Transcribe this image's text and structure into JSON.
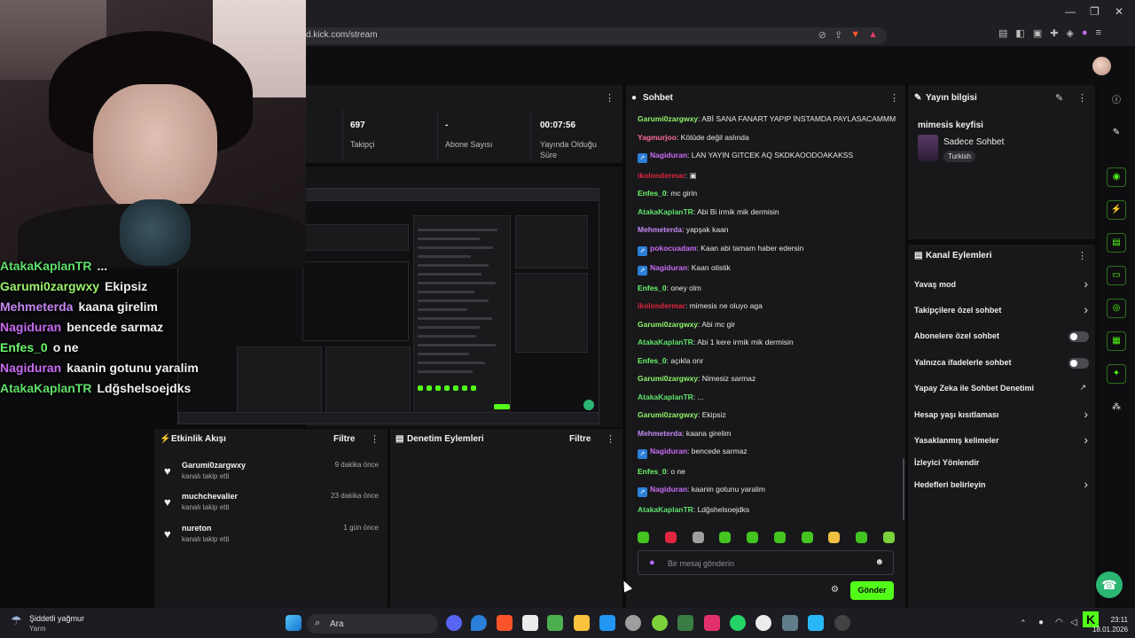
{
  "browser": {
    "url": "d.kick.com/stream",
    "window_controls": [
      "—",
      "❐",
      "✕"
    ]
  },
  "stats": [
    {
      "value": "697",
      "label": "Takipçi"
    },
    {
      "value": "-",
      "label": "Abone Sayısı"
    },
    {
      "value": "00:07:56",
      "label": "Yayında Olduğu Süre"
    }
  ],
  "overlay_chat": [
    {
      "user": "AtakaKaplanTR",
      "msg": "...",
      "color": "#5fe06a"
    },
    {
      "user": "Garumi0zargwxy",
      "msg": "Ekipsiz",
      "color": "#9cf26b"
    },
    {
      "user": "Mehmeterda",
      "msg": "kaana girelim",
      "color": "#c688f5"
    },
    {
      "user": "Nagiduran",
      "msg": "bencede sarmaz",
      "color": "#c86cf2"
    },
    {
      "user": "Enfes_0",
      "msg": "o ne",
      "color": "#6df76d"
    },
    {
      "user": "Nagiduran",
      "msg": "kaanin gotunu yaralim",
      "color": "#c86cf2"
    },
    {
      "user": "AtakaKaplanTR",
      "msg": "Ldğshelsoejdks",
      "color": "#5fe06a"
    }
  ],
  "activity": {
    "title": "Etkinlik Akışı",
    "filter": "Filtre",
    "events": [
      {
        "name": "Garumi0zargwxy",
        "sub": "kanalı takip etti",
        "time": "9 dakika önce"
      },
      {
        "name": "muchchevalier",
        "sub": "kanalı takip etti",
        "time": "23 dakika önce"
      },
      {
        "name": "nureton",
        "sub": "kanalı takip etti",
        "time": "1 gün önce"
      }
    ]
  },
  "moderation": {
    "title": "Denetim Eylemleri",
    "filter": "Filtre"
  },
  "chat": {
    "title": "Sohbet",
    "messages": [
      {
        "user": "Garumi0zargwxy",
        "color": "#8ff56b",
        "badge": "",
        "text": "ABİ SANA FANART YAPIP İNSTAMDA PAYLASACAMMM"
      },
      {
        "user": "Yagmurjoo",
        "color": "#ff6b9a",
        "badge": "",
        "text": "Kötüde değil aslında"
      },
      {
        "user": "Nagiduran",
        "color": "#c86cf2",
        "badge": "⇗",
        "text": "LAN YAYIN GITCEK AQ SKDKAOODOAKAKSS"
      },
      {
        "user": "ikolondermar",
        "color": "#e0263e",
        "badge": "",
        "text": "▣"
      },
      {
        "user": "Enfes_0",
        "color": "#6df76d",
        "badge": "",
        "text": "mc girin"
      },
      {
        "user": "AtakaKaplanTR",
        "color": "#5fe06a",
        "badge": "",
        "text": "Abi Bi irmik mik dermisin"
      },
      {
        "user": "Mehmeterda",
        "color": "#c688f5",
        "badge": "",
        "text": "yapşak kaan"
      },
      {
        "user": "pokocuadam",
        "color": "#c86cf2",
        "badge": "⇗",
        "text": "Kaan abi tamam haber edersin"
      },
      {
        "user": "Nagiduran",
        "color": "#c86cf2",
        "badge": "⇗",
        "text": "Kaan otistik"
      },
      {
        "user": "Enfes_0",
        "color": "#6df76d",
        "badge": "",
        "text": "oney olm"
      },
      {
        "user": "ikolondermar",
        "color": "#e0263e",
        "badge": "",
        "text": "mimesis ne oluyo aga"
      },
      {
        "user": "Garumi0zargwxy",
        "color": "#8ff56b",
        "badge": "",
        "text": "Abi mc gir"
      },
      {
        "user": "AtakaKaplanTR",
        "color": "#5fe06a",
        "badge": "",
        "text": "Abi 1 kere irmik mik dermisin"
      },
      {
        "user": "Enfes_0",
        "color": "#6df76d",
        "badge": "",
        "text": "açıkla onr"
      },
      {
        "user": "Garumi0zargwxy",
        "color": "#8ff56b",
        "badge": "",
        "text": "Nimesiz sarmaz"
      },
      {
        "user": "AtakaKaplanTR",
        "color": "#5fe06a",
        "badge": "",
        "text": "..."
      },
      {
        "user": "Garumi0zargwxy",
        "color": "#8ff56b",
        "badge": "",
        "text": "Ekipsiz"
      },
      {
        "user": "Mehmeterda",
        "color": "#c688f5",
        "badge": "",
        "text": "kaana girelim"
      },
      {
        "user": "Nagiduran",
        "color": "#c86cf2",
        "badge": "⇗",
        "text": "bencede sarmaz"
      },
      {
        "user": "Enfes_0",
        "color": "#6df76d",
        "badge": "",
        "text": "o ne"
      },
      {
        "user": "Nagiduran",
        "color": "#c86cf2",
        "badge": "⇗",
        "text": "kaanin gotunu yaralim"
      },
      {
        "user": "AtakaKaplanTR",
        "color": "#5fe06a",
        "badge": "",
        "text": "Ldğshelsoejdks"
      }
    ],
    "placeholder": "Bir mesaj gönderin",
    "send": "Gönder"
  },
  "stream_info": {
    "title": "Yayın bilgisi",
    "stream_title": "mimesis keyfisi",
    "category": "Sadece Sohbet",
    "language": "Turkish"
  },
  "channel_actions": {
    "title": "Kanal Eylemleri",
    "items": [
      {
        "label": "Yavaş mod",
        "kind": "chevron"
      },
      {
        "label": "Takipçilere özel sohbet",
        "kind": "chevron"
      },
      {
        "label": "Abonelere özel sohbet",
        "kind": "toggle"
      },
      {
        "label": "Yalnızca ifadelerle sohbet",
        "kind": "toggle"
      },
      {
        "label": "Yapay Zeka ile Sohbet Denetimi",
        "kind": "external"
      },
      {
        "label": "Hesap yaşı kısıtlaması",
        "kind": "chevron"
      },
      {
        "label": "Yasaklanmış kelimeler",
        "kind": "chevron"
      },
      {
        "label": "İzleyici Yönlendir",
        "kind": "none"
      },
      {
        "label": "Hedefleri belirleyin",
        "kind": "chevron"
      }
    ]
  },
  "taskbar": {
    "weather_title": "Şiddetli yağmur",
    "weather_sub": "Yarın",
    "search": "Ara",
    "time": "23:11",
    "date": "18.01.2026"
  }
}
